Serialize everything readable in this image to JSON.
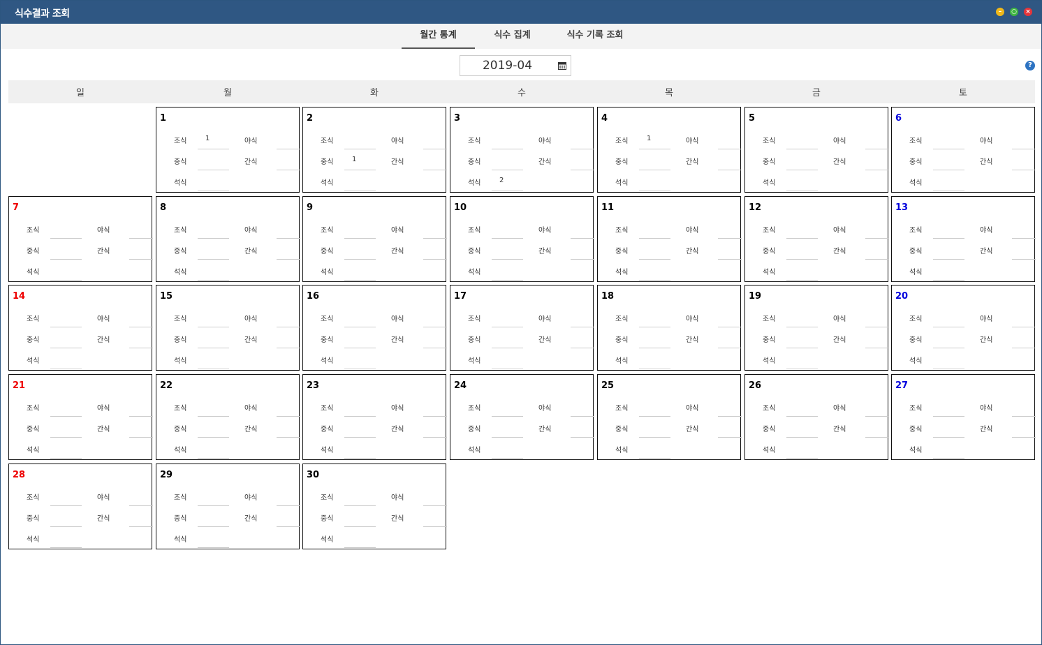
{
  "window": {
    "title": "식수결과 조회"
  },
  "tabs": [
    {
      "label": "월간 통계",
      "active": true
    },
    {
      "label": "식수 집계",
      "active": false
    },
    {
      "label": "식수 기록 조회",
      "active": false
    }
  ],
  "month_picker": {
    "value": "2019-04"
  },
  "help_icon": "?",
  "weekdays": [
    "일",
    "월",
    "화",
    "수",
    "목",
    "금",
    "토"
  ],
  "meal_labels": {
    "breakfast": "조식",
    "lunch": "중식",
    "dinner": "석식",
    "late_night": "야식",
    "snack": "간식"
  },
  "colors": {
    "sunday": "#ee0000",
    "saturday": "#0000dd",
    "titlebar": "#2f5783"
  },
  "days": [
    {
      "day": "1",
      "breakfast": "1",
      "late_night": "",
      "lunch": "",
      "snack": "",
      "dinner": ""
    },
    {
      "day": "2",
      "breakfast": "",
      "late_night": "",
      "lunch": "1",
      "snack": "",
      "dinner": ""
    },
    {
      "day": "3",
      "breakfast": "",
      "late_night": "",
      "lunch": "",
      "snack": "",
      "dinner": "2"
    },
    {
      "day": "4",
      "breakfast": "1",
      "late_night": "",
      "lunch": "",
      "snack": "",
      "dinner": ""
    },
    {
      "day": "5",
      "breakfast": "",
      "late_night": "",
      "lunch": "",
      "snack": "",
      "dinner": ""
    },
    {
      "day": "6",
      "breakfast": "",
      "late_night": "",
      "lunch": "",
      "snack": "",
      "dinner": ""
    },
    {
      "day": "7",
      "breakfast": "",
      "late_night": "",
      "lunch": "",
      "snack": "",
      "dinner": ""
    },
    {
      "day": "8",
      "breakfast": "",
      "late_night": "",
      "lunch": "",
      "snack": "",
      "dinner": ""
    },
    {
      "day": "9",
      "breakfast": "",
      "late_night": "",
      "lunch": "",
      "snack": "",
      "dinner": ""
    },
    {
      "day": "10",
      "breakfast": "",
      "late_night": "",
      "lunch": "",
      "snack": "",
      "dinner": ""
    },
    {
      "day": "11",
      "breakfast": "",
      "late_night": "",
      "lunch": "",
      "snack": "",
      "dinner": ""
    },
    {
      "day": "12",
      "breakfast": "",
      "late_night": "",
      "lunch": "",
      "snack": "",
      "dinner": ""
    },
    {
      "day": "13",
      "breakfast": "",
      "late_night": "",
      "lunch": "",
      "snack": "",
      "dinner": ""
    },
    {
      "day": "14",
      "breakfast": "",
      "late_night": "",
      "lunch": "",
      "snack": "",
      "dinner": ""
    },
    {
      "day": "15",
      "breakfast": "",
      "late_night": "",
      "lunch": "",
      "snack": "",
      "dinner": ""
    },
    {
      "day": "16",
      "breakfast": "",
      "late_night": "",
      "lunch": "",
      "snack": "",
      "dinner": ""
    },
    {
      "day": "17",
      "breakfast": "",
      "late_night": "",
      "lunch": "",
      "snack": "",
      "dinner": ""
    },
    {
      "day": "18",
      "breakfast": "",
      "late_night": "",
      "lunch": "",
      "snack": "",
      "dinner": ""
    },
    {
      "day": "19",
      "breakfast": "",
      "late_night": "",
      "lunch": "",
      "snack": "",
      "dinner": ""
    },
    {
      "day": "20",
      "breakfast": "",
      "late_night": "",
      "lunch": "",
      "snack": "",
      "dinner": ""
    },
    {
      "day": "21",
      "breakfast": "",
      "late_night": "",
      "lunch": "",
      "snack": "",
      "dinner": ""
    },
    {
      "day": "22",
      "breakfast": "",
      "late_night": "",
      "lunch": "",
      "snack": "",
      "dinner": ""
    },
    {
      "day": "23",
      "breakfast": "",
      "late_night": "",
      "lunch": "",
      "snack": "",
      "dinner": ""
    },
    {
      "day": "24",
      "breakfast": "",
      "late_night": "",
      "lunch": "",
      "snack": "",
      "dinner": ""
    },
    {
      "day": "25",
      "breakfast": "",
      "late_night": "",
      "lunch": "",
      "snack": "",
      "dinner": ""
    },
    {
      "day": "26",
      "breakfast": "",
      "late_night": "",
      "lunch": "",
      "snack": "",
      "dinner": ""
    },
    {
      "day": "27",
      "breakfast": "",
      "late_night": "",
      "lunch": "",
      "snack": "",
      "dinner": ""
    },
    {
      "day": "28",
      "breakfast": "",
      "late_night": "",
      "lunch": "",
      "snack": "",
      "dinner": ""
    },
    {
      "day": "29",
      "breakfast": "",
      "late_night": "",
      "lunch": "",
      "snack": "",
      "dinner": ""
    },
    {
      "day": "30",
      "breakfast": "",
      "late_night": "",
      "lunch": "",
      "snack": "",
      "dinner": ""
    }
  ]
}
